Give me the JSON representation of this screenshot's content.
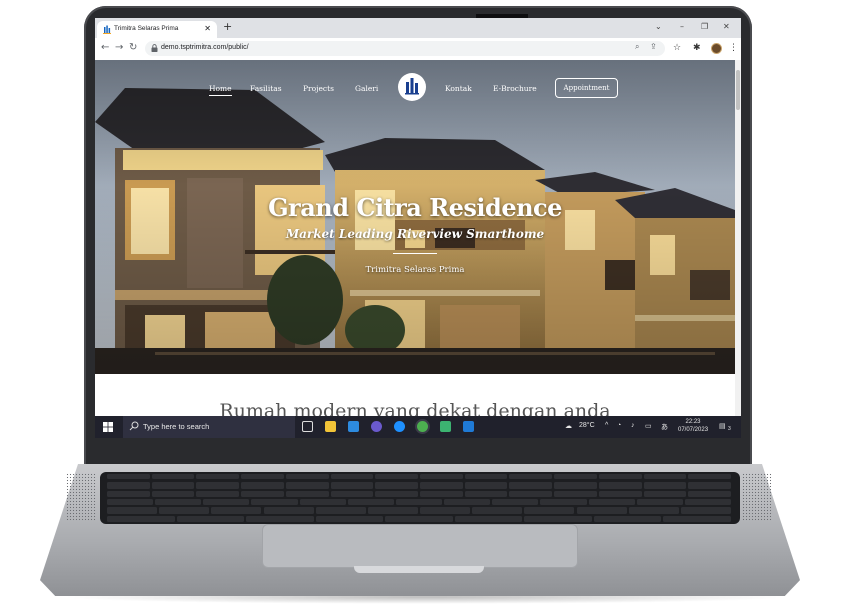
{
  "browser": {
    "tab_title": "Trimitra Selaras Prima",
    "tab_close": "✕",
    "new_tab": "+",
    "url": "demo.tsptrimitra.com/public/",
    "window_controls": [
      "⌄",
      "–",
      "❐",
      "✕"
    ]
  },
  "site": {
    "nav": {
      "home": "Home",
      "fasilitas": "Fasilitas",
      "projects": "Projects",
      "galeri": "Galeri",
      "kontak": "Kontak",
      "ebrochure": "E-Brochure",
      "appointment": "Appointment"
    },
    "hero": {
      "title": "Grand Citra Residence",
      "subtitle": "Market Leading Riverview Smarthome",
      "company": "Trimitra Selaras Prima"
    },
    "section_heading": "Rumah modern yang dekat dengan anda"
  },
  "taskbar": {
    "search_placeholder": "Type here to search",
    "weather": "28°C",
    "time": "22:23",
    "date": "07/07/2023",
    "notification_count": "3"
  },
  "colors": {
    "taskbar": "#20212c",
    "laptop_bezel": "#2a2b2e",
    "laptop_body": "#b4b6ba"
  }
}
